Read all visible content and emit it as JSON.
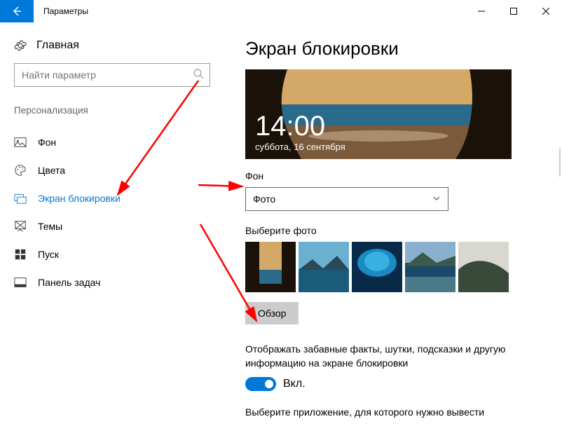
{
  "window": {
    "title": "Параметры"
  },
  "sidebar": {
    "home": "Главная",
    "search_placeholder": "Найти параметр",
    "section": "Персонализация",
    "items": [
      {
        "label": "Фон"
      },
      {
        "label": "Цвета"
      },
      {
        "label": "Экран блокировки",
        "active": true
      },
      {
        "label": "Темы"
      },
      {
        "label": "Пуск"
      },
      {
        "label": "Панель задач"
      }
    ]
  },
  "main": {
    "title": "Экран блокировки",
    "preview": {
      "time": "14:00",
      "date": "суббота, 16 сентября"
    },
    "bg_label": "Фон",
    "bg_value": "Фото",
    "pick_label": "Выберите фото",
    "browse": "Обзор",
    "facts": "Отображать забавные факты, шутки, подсказки и другую информацию на экране блокировки",
    "toggle_on": "Вкл.",
    "app_label": "Выберите приложение, для которого нужно вывести"
  }
}
